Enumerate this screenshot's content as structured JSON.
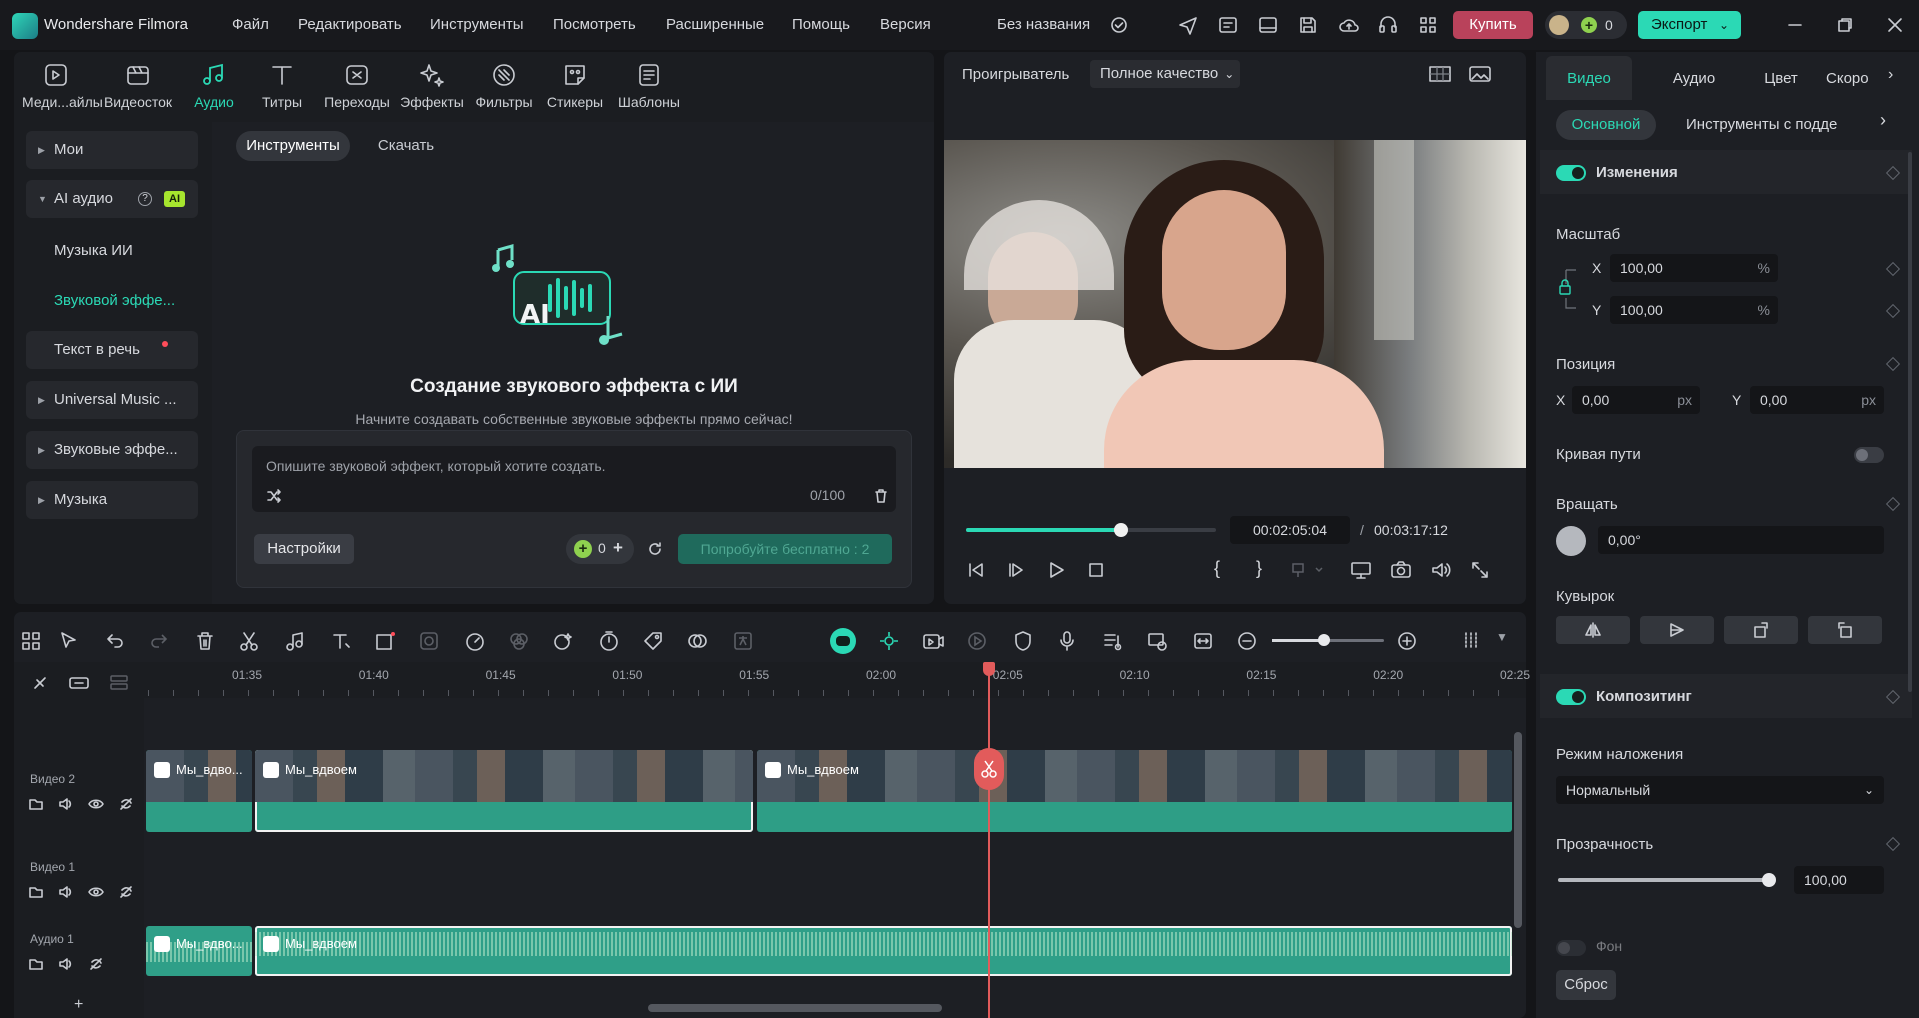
{
  "app": {
    "name": "Wondershare Filmora",
    "project_name": "Без названия",
    "menu": [
      "Файл",
      "Редактировать",
      "Инструменты",
      "Посмотреть",
      "Расширенные",
      "Помощь",
      "Версия"
    ],
    "buy_label": "Купить",
    "credits": "0",
    "export_label": "Экспорт"
  },
  "media_tabs": [
    "Меди...айлы",
    "Видеосток",
    "Аудио",
    "Титры",
    "Переходы",
    "Эффекты",
    "Фильтры",
    "Стикеры",
    "Шаблоны"
  ],
  "sidebar": {
    "mine": "Мои",
    "ai_audio": "AI аудио",
    "ai_badge": "AI",
    "ai_music": "Музыка ИИ",
    "sound_fx": "Звуковой эффе...",
    "tts": "Текст в речь",
    "universal": "Universal Music ...",
    "sound_effects": "Звуковые эффе...",
    "music": "Музыка"
  },
  "subtabs": {
    "tools": "Инструменты",
    "download": "Скачать"
  },
  "ai_fx": {
    "badge": "AI",
    "title": "Создание звукового эффекта с ИИ",
    "subtitle": "Начните создавать собственные звуковые эффекты прямо сейчас!",
    "placeholder": "Опишите звуковой эффект, который хотите создать.",
    "counter": "0/100",
    "settings_label": "Настройки",
    "credits": "0",
    "try_label": "Попробуйте бесплатно : 2"
  },
  "player": {
    "label": "Проигрыватель",
    "quality": "Полное качество",
    "current_time": "00:02:05:04",
    "separator": "/",
    "total_time": "00:03:17:12",
    "progress": 0.62
  },
  "inspector": {
    "tabs": [
      "Видео",
      "Аудио",
      "Цвет",
      "Скоро"
    ],
    "subtabs": [
      "Основной",
      "Инструменты с подде"
    ],
    "changes": "Изменения",
    "scale": "Масштаб",
    "scale_x_label": "X",
    "scale_x": "100,00",
    "scale_y_label": "Y",
    "scale_y": "100,00",
    "percent": "%",
    "position": "Позиция",
    "pos_x_label": "X",
    "pos_x": "0,00",
    "pos_y_label": "Y",
    "pos_y": "0,00",
    "px": "px",
    "path_curve": "Кривая пути",
    "rotate": "Вращать",
    "rotate_value": "0,00°",
    "flip": "Кувырок",
    "compositing": "Композитинг",
    "blend_mode_label": "Режим наложения",
    "blend_mode": "Нормальный",
    "opacity_label": "Прозрачность",
    "opacity": "100,00",
    "background": "Фон",
    "reset": "Сброс"
  },
  "timeline": {
    "ruler": [
      "01:35",
      "01:40",
      "01:45",
      "01:50",
      "01:55",
      "02:00",
      "02:05",
      "02:10",
      "02:15",
      "02:20",
      "02:25"
    ],
    "tracks": [
      "Видео 2",
      "Видео 1",
      "Аудио 1"
    ],
    "clip_title": "Мы_вдвоем",
    "clip_title_short": "Мы_вдво...",
    "add_track": "+"
  },
  "colors": {
    "accent": "#2bd9b5",
    "buy": "#b9425b",
    "clip": "#2e9e86",
    "playhead": "#e25b5b"
  }
}
